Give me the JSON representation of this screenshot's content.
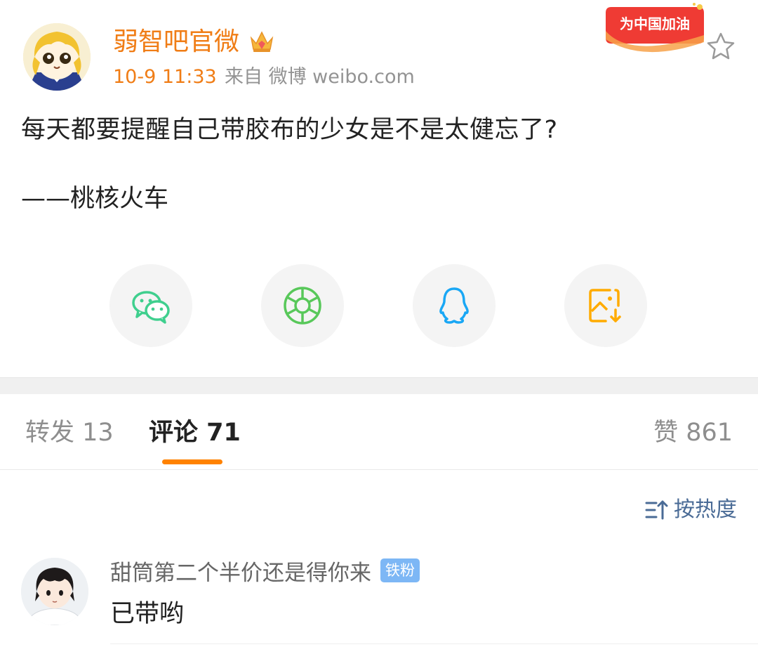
{
  "post": {
    "author": {
      "name": "弱智吧官微",
      "avatar_icon": "anime-girl-avatar",
      "badge_icon": "crown-icon"
    },
    "time": "10-9 11:33",
    "source": "来自 微博 weibo.com",
    "promo_badge": "为中国加油",
    "text": "每天都要提醒自己带胶布的少女是不是太健忘了?",
    "attribution": "——桃核火车"
  },
  "share": [
    {
      "name": "wechat",
      "icon": "wechat-icon",
      "color": "#3fcf8e"
    },
    {
      "name": "moments",
      "icon": "moments-icon",
      "color": "#58c85a"
    },
    {
      "name": "qq",
      "icon": "qq-icon",
      "color": "#19a7f5"
    },
    {
      "name": "save-image",
      "icon": "save-image-icon",
      "color": "#ffab00"
    }
  ],
  "tabs": {
    "repost": "转发 13",
    "comment": "评论 71",
    "likes": "赞 861",
    "active": "comment"
  },
  "sort": {
    "label": "按热度",
    "icon": "sort-icon"
  },
  "comments": [
    {
      "user": "甜筒第二个半价还是得你来",
      "badge": "铁粉",
      "text": "已带哟",
      "avatar_icon": "anime-boy-avatar"
    }
  ],
  "colors": {
    "accent": "#ff8200",
    "username": "#f07d16",
    "link": "#4a6b96",
    "badge_blue": "#7db7f5"
  }
}
